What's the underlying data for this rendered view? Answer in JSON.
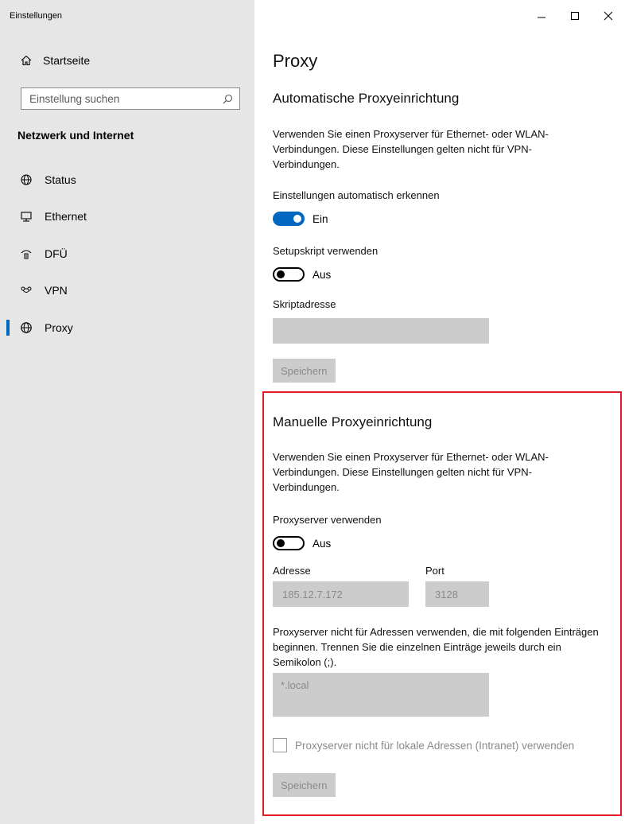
{
  "app": {
    "title": "Einstellungen"
  },
  "sidebar": {
    "home_label": "Startseite",
    "search_placeholder": "Einstellung suchen",
    "section_heading": "Netzwerk und Internet",
    "items": [
      {
        "label": "Status",
        "icon": "status-globe-icon"
      },
      {
        "label": "Ethernet",
        "icon": "ethernet-icon"
      },
      {
        "label": "DFÜ",
        "icon": "dialup-icon"
      },
      {
        "label": "VPN",
        "icon": "vpn-icon"
      },
      {
        "label": "Proxy",
        "icon": "proxy-globe-icon",
        "selected": true
      }
    ]
  },
  "window_controls": {
    "minimize": "—",
    "maximize": "☐",
    "close": "✕"
  },
  "page": {
    "title": "Proxy",
    "auto": {
      "title": "Automatische Proxyeinrichtung",
      "description": "Verwenden Sie einen Proxyserver für Ethernet- oder WLAN-Verbindungen. Diese Einstellungen gelten nicht für VPN-Verbindungen.",
      "detect_label": "Einstellungen automatisch erkennen",
      "detect_state": "Ein",
      "script_label": "Setupskript verwenden",
      "script_state": "Aus",
      "address_label": "Skriptadresse",
      "address_value": "",
      "save_label": "Speichern"
    },
    "manual": {
      "title": "Manuelle Proxyeinrichtung",
      "description": "Verwenden Sie einen Proxyserver für Ethernet- oder WLAN-Verbindungen. Diese Einstellungen gelten nicht für VPN-Verbindungen.",
      "use_proxy_label": "Proxyserver verwenden",
      "use_proxy_state": "Aus",
      "address_label": "Adresse",
      "address_value": "185.12.7.172",
      "port_label": "Port",
      "port_value": "3128",
      "exceptions_description": "Proxyserver nicht für Adressen verwenden, die mit folgenden Einträgen beginnen. Trennen Sie die einzelnen Einträge jeweils durch ein Semikolon (;).",
      "exceptions_value": "*.local",
      "local_checkbox_label": "Proxyserver nicht für lokale Adressen (Intranet) verwenden",
      "save_label": "Speichern"
    }
  },
  "colors": {
    "accent": "#0067c0",
    "highlight_border": "#e01b24",
    "sidebar_bg": "#e6e6e6",
    "disabled_field": "#cccccc"
  }
}
